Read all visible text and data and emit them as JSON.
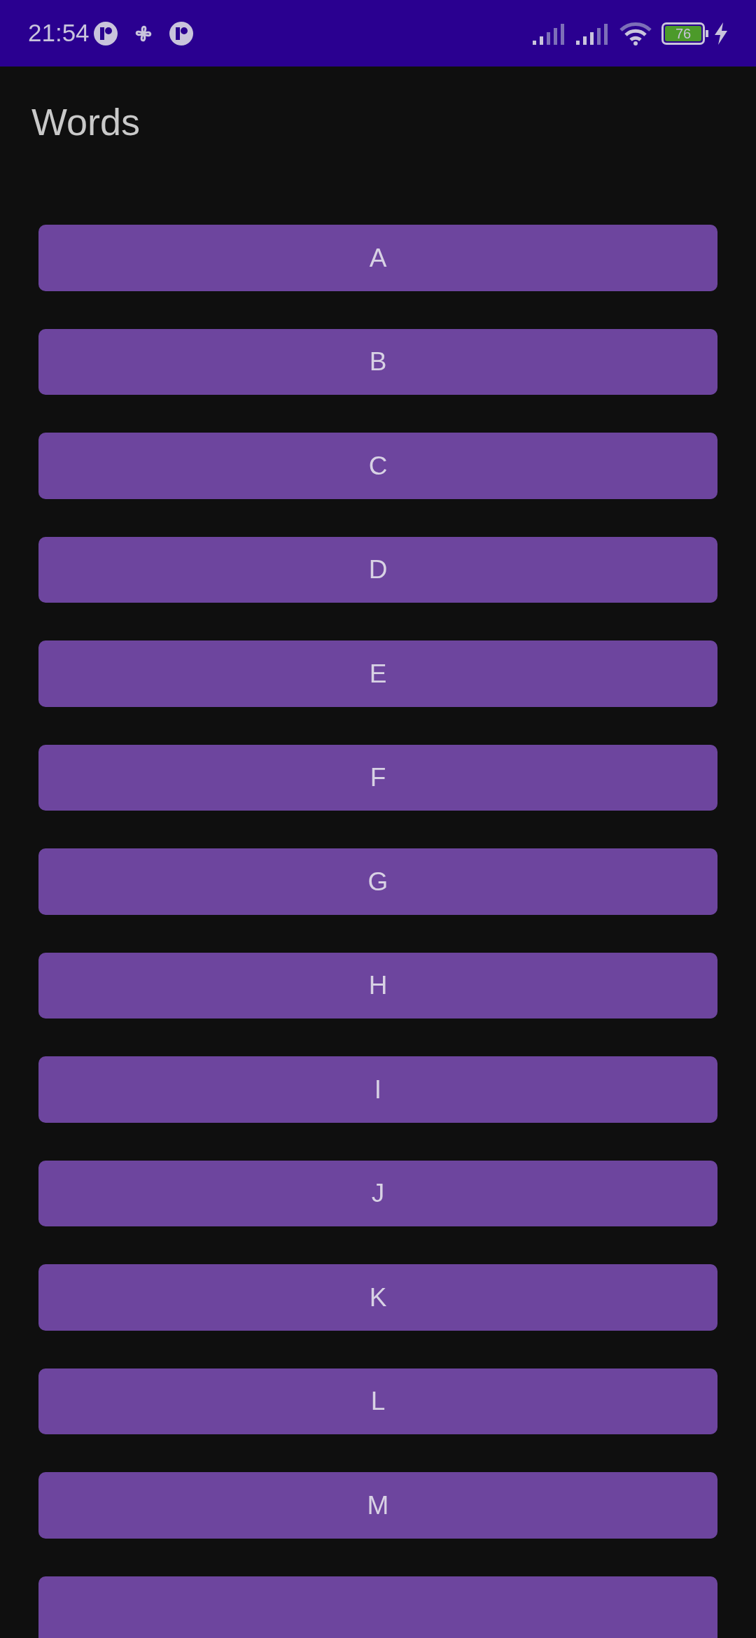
{
  "status_bar": {
    "time": "21:54",
    "battery": "76",
    "charging": true
  },
  "title": "Words",
  "buttons": [
    "A",
    "B",
    "C",
    "D",
    "E",
    "F",
    "G",
    "H",
    "I",
    "J",
    "K",
    "L",
    "M"
  ],
  "more_below": true
}
